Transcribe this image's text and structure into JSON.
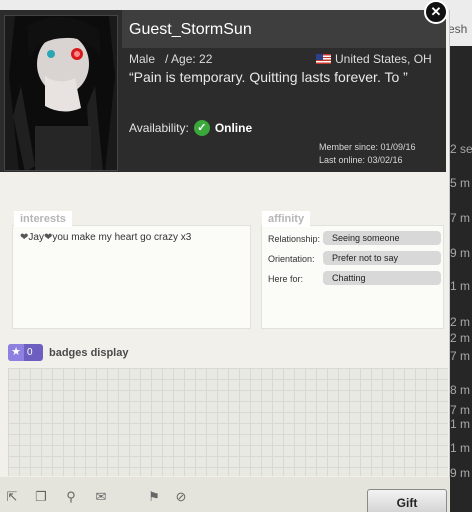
{
  "background": {
    "top_text": "esh",
    "side_rows": [
      "2 se",
      "5 m",
      "7 m",
      "9 m",
      "1 m",
      "2 m",
      "2 m",
      "7 m",
      "8 m",
      "7 m",
      "1 m",
      "1 m",
      "9 m"
    ]
  },
  "profile": {
    "username": "Guest_StormSun",
    "gender": "Male",
    "age_text": "/ Age: 22",
    "location": "United States, OH",
    "status_quote": "“Pain is temporary. Quitting lasts forever. To ”",
    "availability_label": "Availability:",
    "availability_value": "Online",
    "member_since": "Member since: 01/09/16",
    "last_online": "Last online: 03/02/16"
  },
  "interests": {
    "title": "interests",
    "text_segments": [
      "❤",
      "Jay",
      "❤",
      "you make my heart go crazy x3"
    ]
  },
  "affinity": {
    "title": "affinity",
    "rows": [
      {
        "label": "Relationship:",
        "value": "Seeing someone"
      },
      {
        "label": "Orientation:",
        "value": "Prefer not to say"
      },
      {
        "label": "Here for:",
        "value": "Chatting"
      }
    ]
  },
  "badges": {
    "count": "0",
    "label": "badges display"
  },
  "footer": {
    "gift_label": "Gift",
    "tools": [
      "external-link-icon",
      "copy-icon",
      "gift-tag-icon",
      "mail-icon",
      "flag-icon",
      "block-icon"
    ]
  },
  "colors": {
    "online": "#3aa83a",
    "badge": "#6d5fc0"
  }
}
